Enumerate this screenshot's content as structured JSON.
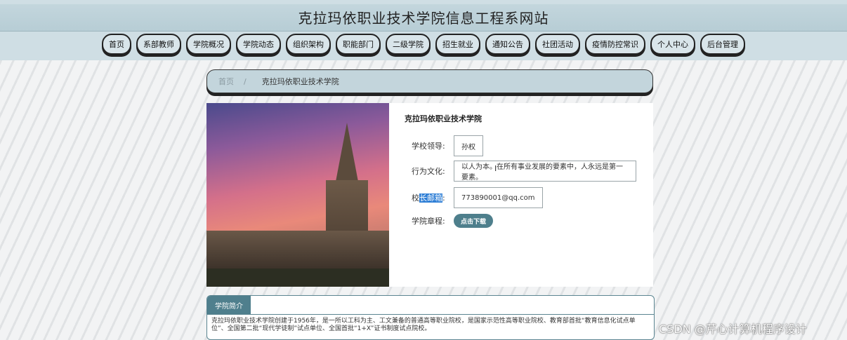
{
  "header": {
    "site_title": "克拉玛依职业技术学院信息工程系网站"
  },
  "nav": {
    "items": [
      {
        "label": "首页"
      },
      {
        "label": "系部教师"
      },
      {
        "label": "学院概况"
      },
      {
        "label": "学院动态"
      },
      {
        "label": "组织架构"
      },
      {
        "label": "职能部门"
      },
      {
        "label": "二级学院"
      },
      {
        "label": "招生就业"
      },
      {
        "label": "通知公告"
      },
      {
        "label": "社团活动"
      },
      {
        "label": "疫情防控常识"
      },
      {
        "label": "个人中心"
      },
      {
        "label": "后台管理"
      }
    ]
  },
  "breadcrumb": {
    "home": "首页",
    "separator": "/",
    "current": "克拉玛依职业技术学院"
  },
  "detail": {
    "title": "克拉玛依职业技术学院",
    "leader_label": "学校领导:",
    "leader_value": "孙权",
    "culture_label": "行为文化:",
    "culture_value": "以人为本。在所有事业发展的要素中，人永远是第一要素。",
    "email_label_prefix": "校",
    "email_label_highlight": "长邮箱",
    "email_label_suffix": ":",
    "email_value": "773890001@qq.com",
    "charter_label": "学院章程:",
    "download_button": "点击下载"
  },
  "intro": {
    "tab": "学院简介",
    "text": "克拉玛依职业技术学院创建于1956年，是一所以工科为主、工文兼备的普通高等职业院校，是国家示范性高等职业院校、教育部首批“教育信息化试点单位”、全国第二批“现代学徒制”试点单位、全国首批“1+X”证书制度试点院校。"
  },
  "watermark": "CSDN @芹心计算机程序设计",
  "colors": {
    "header_bg": "#cfdee4",
    "accent": "#4f7f8d",
    "highlight": "#2f7fd6"
  }
}
